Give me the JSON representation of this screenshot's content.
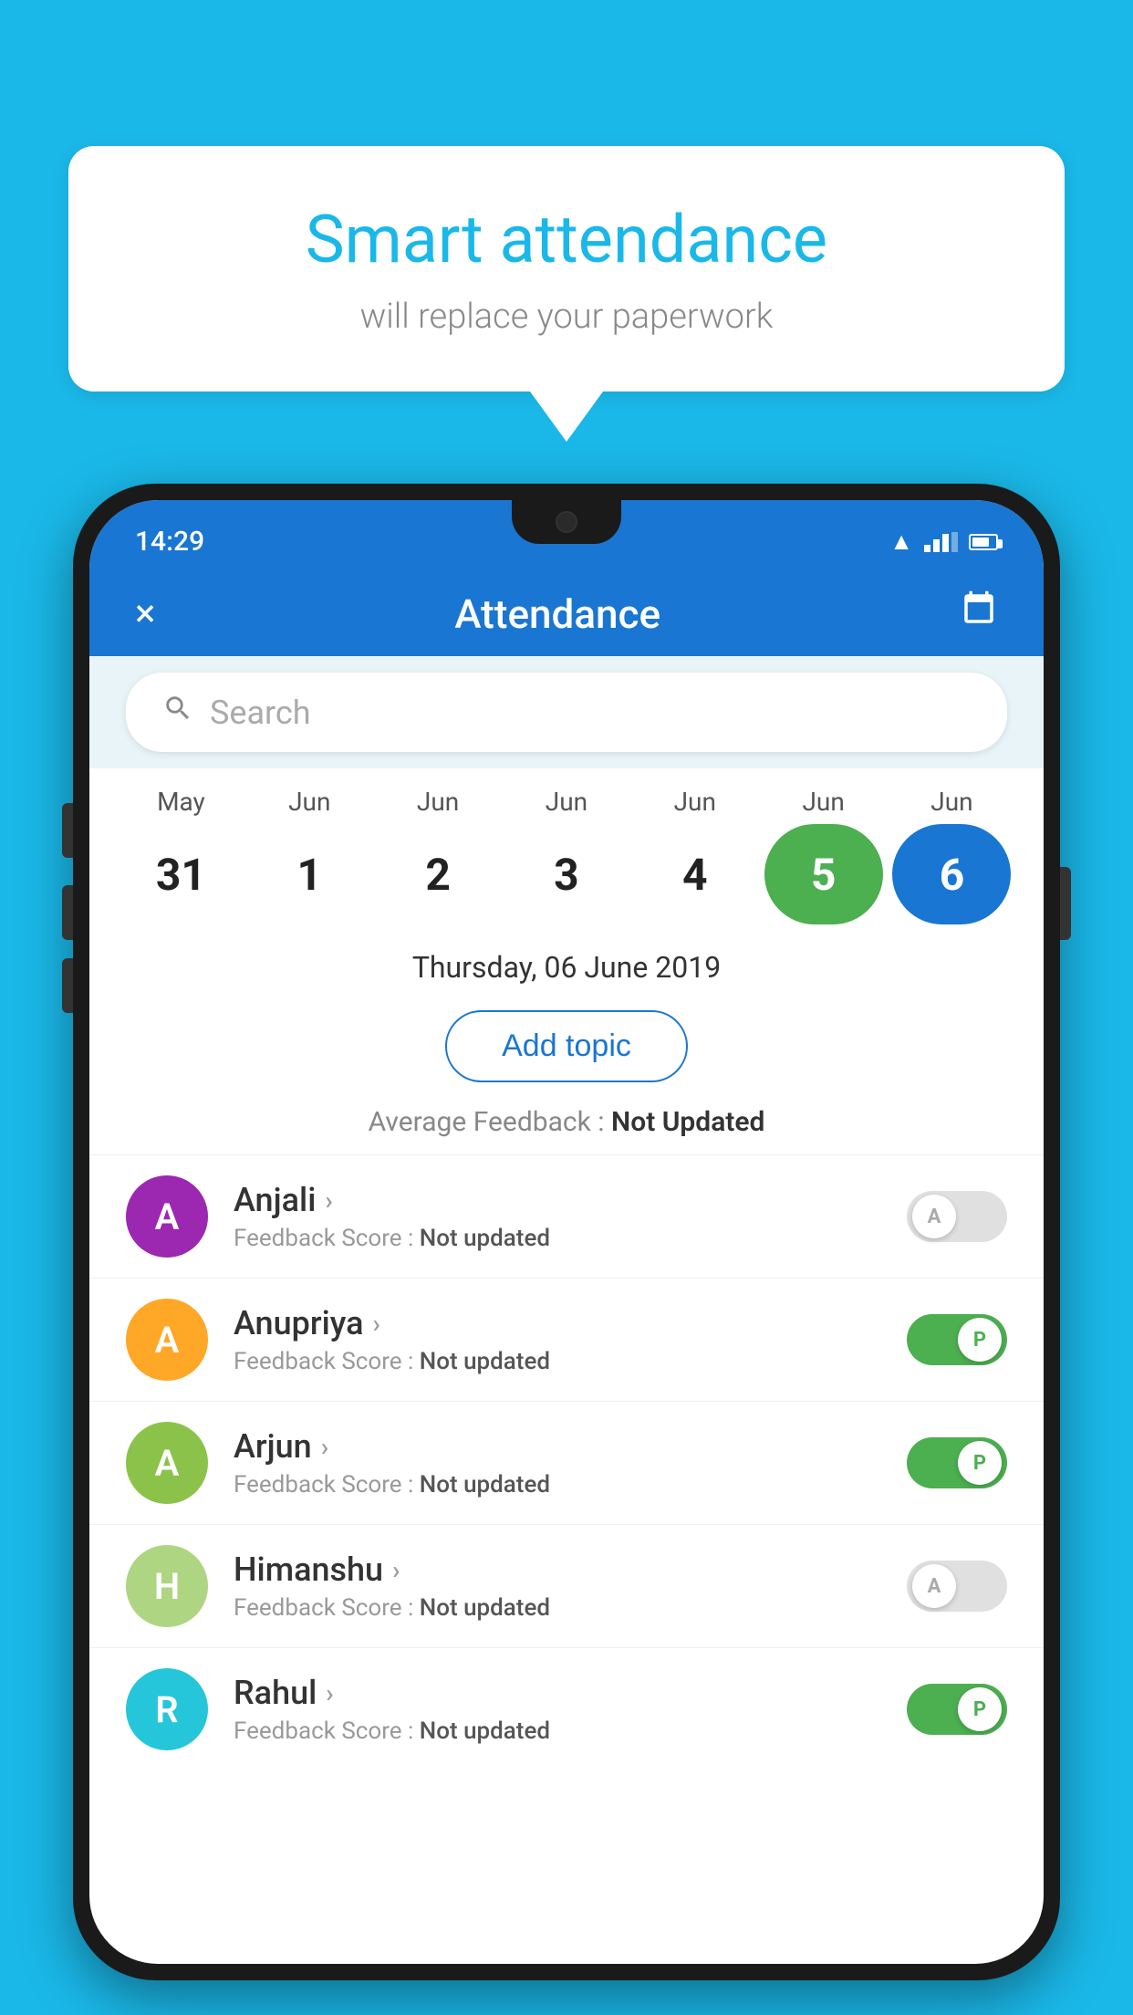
{
  "background_color": "#1ab8e8",
  "speech_bubble": {
    "title": "Smart attendance",
    "subtitle": "will replace your paperwork"
  },
  "status_bar": {
    "time": "14:29",
    "accent_color": "#1976d2"
  },
  "app_bar": {
    "title": "Attendance",
    "close_label": "×",
    "calendar_label": "📅"
  },
  "search": {
    "placeholder": "Search"
  },
  "calendar": {
    "days": [
      {
        "month": "May",
        "date": "31",
        "state": "normal"
      },
      {
        "month": "Jun",
        "date": "1",
        "state": "normal"
      },
      {
        "month": "Jun",
        "date": "2",
        "state": "normal"
      },
      {
        "month": "Jun",
        "date": "3",
        "state": "normal"
      },
      {
        "month": "Jun",
        "date": "4",
        "state": "normal"
      },
      {
        "month": "Jun",
        "date": "5",
        "state": "today"
      },
      {
        "month": "Jun",
        "date": "6",
        "state": "selected"
      }
    ]
  },
  "selected_date": "Thursday, 06 June 2019",
  "add_topic_label": "Add topic",
  "average_feedback": {
    "label": "Average Feedback : ",
    "value": "Not Updated"
  },
  "students": [
    {
      "name": "Anjali",
      "initial": "A",
      "avatar_color": "#9c27b0",
      "feedback_label": "Feedback Score : ",
      "feedback_value": "Not updated",
      "toggle_state": "off",
      "toggle_label": "A"
    },
    {
      "name": "Anupriya",
      "initial": "A",
      "avatar_color": "#ffa726",
      "feedback_label": "Feedback Score : ",
      "feedback_value": "Not updated",
      "toggle_state": "on",
      "toggle_label": "P"
    },
    {
      "name": "Arjun",
      "initial": "A",
      "avatar_color": "#8bc34a",
      "feedback_label": "Feedback Score : ",
      "feedback_value": "Not updated",
      "toggle_state": "on",
      "toggle_label": "P"
    },
    {
      "name": "Himanshu",
      "initial": "H",
      "avatar_color": "#aed581",
      "feedback_label": "Feedback Score : ",
      "feedback_value": "Not updated",
      "toggle_state": "off",
      "toggle_label": "A"
    },
    {
      "name": "Rahul",
      "initial": "R",
      "avatar_color": "#26c6da",
      "feedback_label": "Feedback Score : ",
      "feedback_value": "Not updated",
      "toggle_state": "on",
      "toggle_label": "P"
    }
  ]
}
